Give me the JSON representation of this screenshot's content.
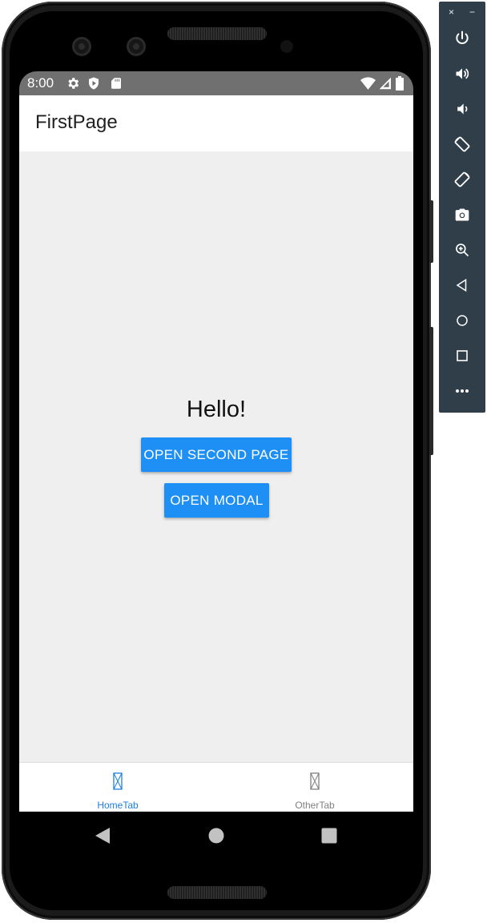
{
  "status_bar": {
    "time": "8:00",
    "icons": [
      "settings-gear-icon",
      "play-protect-icon",
      "sd-card-icon",
      "wifi-icon",
      "cell-signal-icon",
      "battery-icon"
    ]
  },
  "app_bar": {
    "title": "FirstPage"
  },
  "main": {
    "greeting": "Hello!",
    "open_second_page_label": "OPEN SECOND PAGE",
    "open_modal_label": "OPEN MODAL"
  },
  "tabs": [
    {
      "label": "HomeTab",
      "icon": "tab-placeholder-icon",
      "selected": true
    },
    {
      "label": "OtherTab",
      "icon": "tab-placeholder-icon",
      "selected": false
    }
  ],
  "nav_bar": {
    "buttons": [
      "back-icon",
      "home-icon",
      "recents-icon"
    ]
  },
  "emulator_panel": {
    "window_controls": [
      "×",
      "−"
    ],
    "tools": [
      "power-icon",
      "volume-up-icon",
      "volume-down-icon",
      "rotate-left-icon",
      "rotate-right-icon",
      "screenshot-icon",
      "zoom-icon",
      "back-icon",
      "home-icon",
      "overview-icon",
      "more-icon"
    ]
  },
  "colors": {
    "accent_button": "#1e8ff4",
    "tab_selected": "#1e7fe0",
    "tab_unselected": "#808080",
    "status_bar": "#707070",
    "content_background": "#efefef",
    "emulator_panel": "#2f3e48"
  }
}
